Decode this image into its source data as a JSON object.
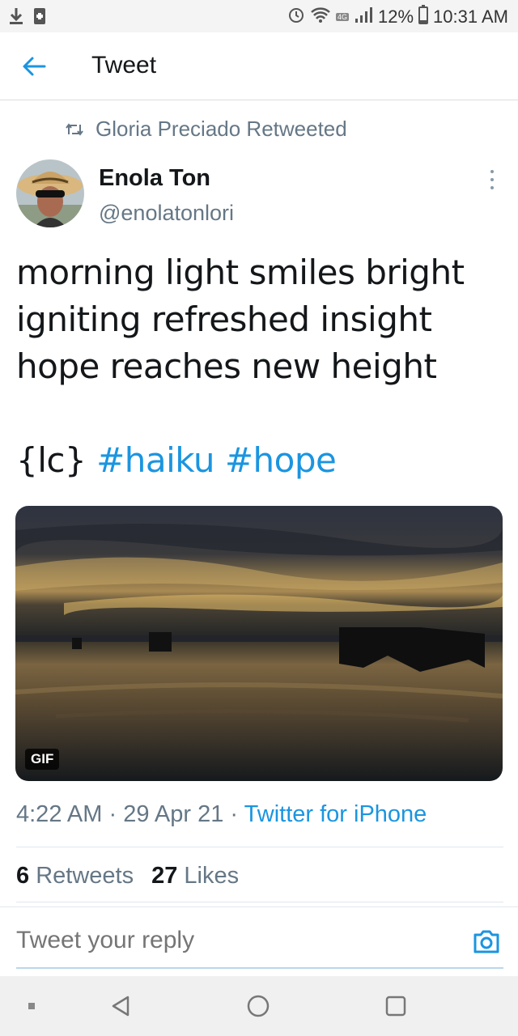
{
  "status_bar": {
    "battery": "12%",
    "time": "10:31 AM",
    "network": "4G",
    "icons": [
      "download-icon",
      "storage-icon",
      "alarm-icon",
      "wifi-icon",
      "signal-icon",
      "battery-icon"
    ]
  },
  "app_bar": {
    "title": "Tweet",
    "back_icon": "arrow-left-icon"
  },
  "retweet_notice": {
    "text": "Gloria Preciado Retweeted",
    "icon": "retweet-icon"
  },
  "author": {
    "name": "Enola Ton",
    "handle": "@enolatonlori"
  },
  "tweet": {
    "lines": [
      "morning light smiles bright",
      "igniting refreshed insight",
      "hope reaches new height"
    ],
    "tag_prefix": "{lc}",
    "hashtags": [
      "#haiku",
      "#hope"
    ]
  },
  "media": {
    "badge": "GIF"
  },
  "meta": {
    "time": "4:22 AM",
    "separator": "·",
    "date": "29 Apr 21",
    "source": "Twitter for iPhone"
  },
  "stats": {
    "retweets_count": "6",
    "retweets_label": "Retweets",
    "likes_count": "27",
    "likes_label": "Likes"
  },
  "reply": {
    "placeholder": "Tweet your reply",
    "icon": "camera-icon"
  },
  "colors": {
    "accent": "#1b95e0",
    "text": "#14171a",
    "muted": "#657786"
  }
}
